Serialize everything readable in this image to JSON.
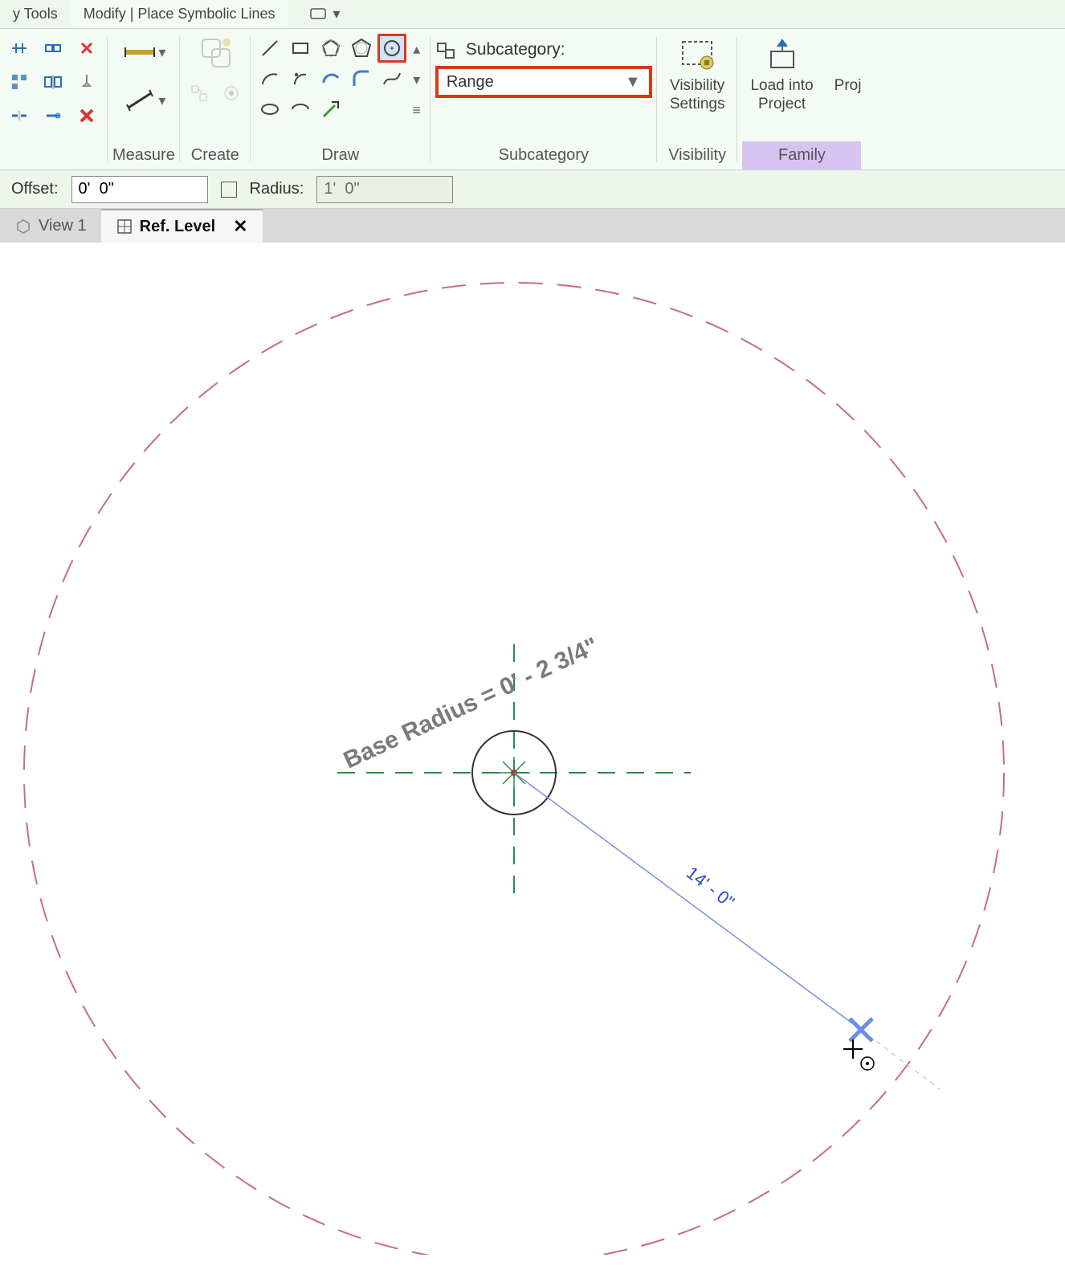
{
  "tabs": {
    "prev": "y Tools",
    "active": "Modify | Place Symbolic Lines"
  },
  "panels": {
    "measure": "Measure",
    "create": "Create",
    "draw": "Draw",
    "subcategory": "Subcategory",
    "visibility": "Visibility",
    "family": "Family"
  },
  "subcat": {
    "label": "Subcategory:",
    "value": "Range"
  },
  "buttons": {
    "visibility": "Visibility\nSettings",
    "load": "Load into\nProject",
    "proj": "Proj"
  },
  "options": {
    "offset_label": "Offset:",
    "offset_value": "0'  0\"",
    "radius_label": "Radius:",
    "radius_value": "1'  0\""
  },
  "viewtabs": {
    "v1": "View 1",
    "ref": "Ref. Level"
  },
  "drawing": {
    "param_label": "Base Radius = 0' - 2 3/4\"",
    "radius_dim": "14' - 0\""
  }
}
